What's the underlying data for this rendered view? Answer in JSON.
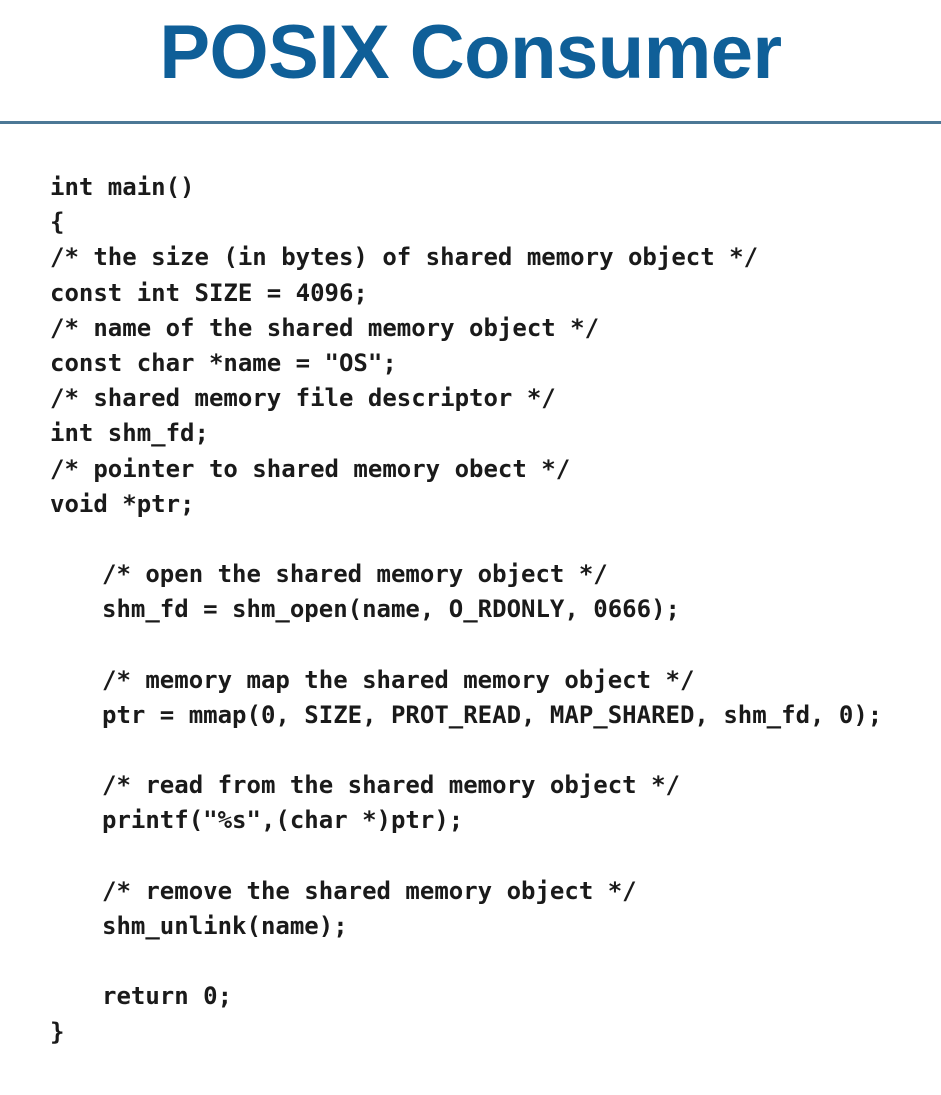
{
  "slide": {
    "title": "POSIX Consumer",
    "title_color": "#0f5f98",
    "rule_color": "#4c7896"
  },
  "code": {
    "lines": [
      "int main()",
      "{",
      "/* the size (in bytes) of shared memory object */",
      "const int SIZE = 4096;",
      "/* name of the shared memory object */",
      "const char *name = \"OS\";",
      "/* shared memory file descriptor */",
      "int shm_fd;",
      "/* pointer to shared memory obect */",
      "void *ptr;",
      "",
      "/* open the shared memory object */",
      "shm_fd = shm_open(name, O_RDONLY, 0666);",
      "",
      "/* memory map the shared memory object */",
      "ptr = mmap(0, SIZE, PROT_READ, MAP_SHARED, shm_fd, 0);",
      "",
      "/* read from the shared memory object */",
      "printf(\"%s\",(char *)ptr);",
      "",
      "/* remove the shared memory object */",
      "shm_unlink(name);",
      "",
      "return 0;",
      "}"
    ]
  }
}
